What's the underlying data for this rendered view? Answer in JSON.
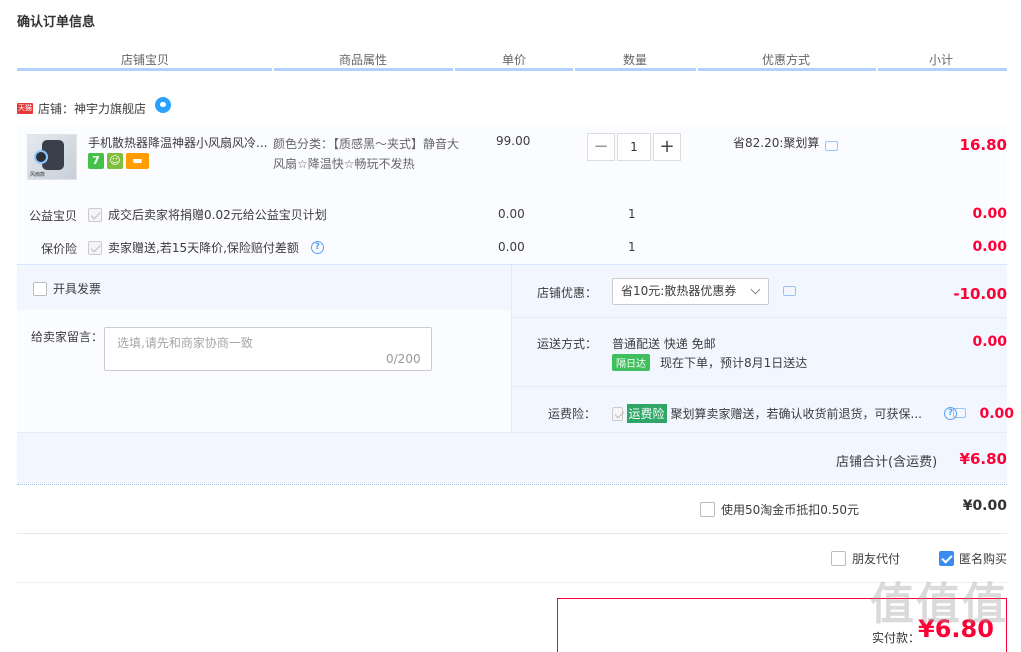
{
  "page_title": "确认订单信息",
  "columns": [
    "店铺宝贝",
    "商品属性",
    "单价",
    "数量",
    "优惠方式",
    "小计"
  ],
  "shop": {
    "tmall_badge": "天猫",
    "name": "店铺：神宇力旗舰店"
  },
  "item": {
    "thumb_label": "风扇款",
    "title": "手机散热器降温神器小风扇风冷...",
    "badges": [
      "7",
      "",
      ""
    ],
    "attr": "颜色分类：【质感黑～夹式】静音大风扇☆降温快☆畅玩不发热",
    "price": "99.00",
    "qty": "1",
    "promo": "省82.20:聚划算",
    "subtotal": "16.80"
  },
  "charity": {
    "label": "公益宝贝",
    "text": "成交后卖家将捐赠0.02元给公益宝贝计划",
    "price": "0.00",
    "qty": "1",
    "subtotal": "0.00"
  },
  "insurance": {
    "label": "保价险",
    "text": "卖家赠送,若15天降价,保险赔付差额",
    "price": "0.00",
    "qty": "1",
    "subtotal": "0.00"
  },
  "invoice": {
    "label": "开具发票"
  },
  "message": {
    "label": "给卖家留言：",
    "placeholder": "选填,请先和商家协商一致",
    "counter": "0/200"
  },
  "shop_discount": {
    "label": "店铺优惠：",
    "selected": "省10元:散热器优惠券",
    "amount": "-10.00"
  },
  "shipping": {
    "label": "运送方式：",
    "method": "普通配送 快递 免邮",
    "tag": "隔日达",
    "eta": "现在下单，预计8月1日送达",
    "amount": "0.00"
  },
  "freight_insurance": {
    "label": "运费险：",
    "tag": "运费险",
    "text": "聚划算卖家赠送，若确认收货前退货，可获保...",
    "amount": "0.00"
  },
  "shop_total": {
    "label": "店铺合计(含运费)",
    "amount": "¥6.80"
  },
  "taobao_coins": {
    "label": "使用50淘金币抵扣0.50元",
    "amount": "¥0.00"
  },
  "friend_pay": {
    "label": "朋友代付"
  },
  "anonymous": {
    "label": "匿名购买"
  },
  "payment": {
    "label": "实付款：",
    "amount": "¥6.80"
  },
  "watermark": "值值值"
}
